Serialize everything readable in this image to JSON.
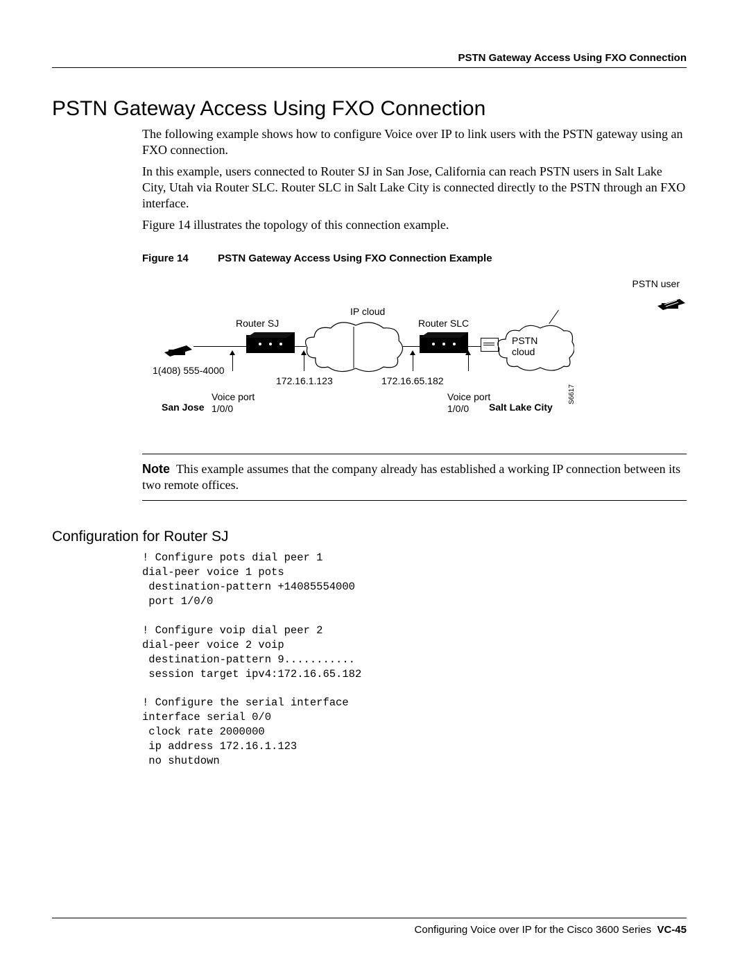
{
  "running_head": "PSTN Gateway Access Using FXO Connection",
  "h1": "PSTN Gateway Access Using FXO Connection",
  "para1": "The following example shows how to configure Voice over IP to link users with the PSTN gateway using an FXO connection.",
  "para2": "In this example, users connected to Router SJ in San Jose, California can reach PSTN users in Salt Lake City, Utah via Router SLC. Router SLC in Salt Lake City is connected directly to the PSTN through an FXO interface.",
  "para3": "Figure 14 illustrates the topology of this connection example.",
  "figure": {
    "label": "Figure 14",
    "title": "PSTN Gateway Access Using FXO Connection Example",
    "labels": {
      "pstn_user": "PSTN user",
      "ip_cloud": "IP cloud",
      "router_sj": "Router SJ",
      "router_slc": "Router SLC",
      "pstn_cloud": "PSTN\ncloud",
      "phone_number": "1(408) 555-4000",
      "ip_sj": "172.16.1.123",
      "ip_slc": "172.16.65.182",
      "voice_port_l": "Voice port\n1/0/0",
      "voice_port_r": "Voice port\n1/0/0",
      "san_jose": "San Jose",
      "salt_lake": "Salt Lake City",
      "diag_id": "S6617"
    }
  },
  "note_label": "Note",
  "note_text": "This example assumes that the company already has established a working IP connection between its two remote offices.",
  "h2": "Configuration for Router SJ",
  "code": "! Configure pots dial peer 1\ndial-peer voice 1 pots\n destination-pattern +14085554000\n port 1/0/0\n\n! Configure voip dial peer 2\ndial-peer voice 2 voip\n destination-pattern 9...........\n session target ipv4:172.16.65.182\n\n! Configure the serial interface\ninterface serial 0/0\n clock rate 2000000\n ip address 172.16.1.123\n no shutdown",
  "footer_text": "Configuring Voice over IP for the Cisco 3600 Series",
  "footer_page": "VC-45"
}
